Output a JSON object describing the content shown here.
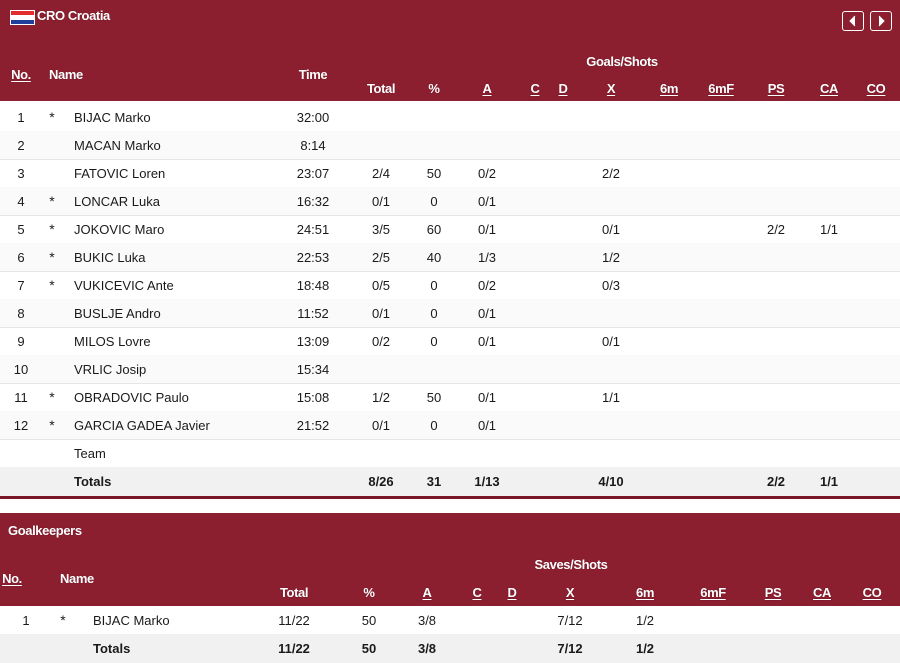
{
  "team": {
    "label": "CRO Croatia",
    "flag_colors": [
      "#e12d2d",
      "#ffffff",
      "#1e3f9c"
    ]
  },
  "nav": {
    "prev_icon": "chevron-left-icon",
    "next_icon": "chevron-right-icon"
  },
  "colors": {
    "band": "#8b1e2f",
    "divider": "#7a1828"
  },
  "players_table": {
    "group_label": "Goals/Shots",
    "headers": {
      "no": "No.",
      "name": "Name",
      "time": "Time",
      "total": "Total",
      "pct": "%",
      "a": "A",
      "c": "C",
      "d": "D",
      "x": "X",
      "m6": "6m",
      "m6f": "6mF",
      "ps": "PS",
      "ca": "CA",
      "co": "CO"
    },
    "rows": [
      {
        "no": "1",
        "star": "*",
        "name": "BIJAC Marko",
        "time": "32:00",
        "total": "",
        "pct": "",
        "a": "",
        "x": "",
        "ps": "",
        "ca": ""
      },
      {
        "no": "2",
        "star": "",
        "name": "MACAN Marko",
        "time": "8:14",
        "total": "",
        "pct": "",
        "a": "",
        "x": "",
        "ps": "",
        "ca": ""
      },
      {
        "no": "3",
        "star": "",
        "name": "FATOVIC Loren",
        "time": "23:07",
        "total": "2/4",
        "pct": "50",
        "a": "0/2",
        "x": "2/2",
        "ps": "",
        "ca": ""
      },
      {
        "no": "4",
        "star": "*",
        "name": "LONCAR Luka",
        "time": "16:32",
        "total": "0/1",
        "pct": "0",
        "a": "0/1",
        "x": "",
        "ps": "",
        "ca": ""
      },
      {
        "no": "5",
        "star": "*",
        "name": "JOKOVIC Maro",
        "time": "24:51",
        "total": "3/5",
        "pct": "60",
        "a": "0/1",
        "x": "0/1",
        "ps": "2/2",
        "ca": "1/1"
      },
      {
        "no": "6",
        "star": "*",
        "name": "BUKIC Luka",
        "time": "22:53",
        "total": "2/5",
        "pct": "40",
        "a": "1/3",
        "x": "1/2",
        "ps": "",
        "ca": ""
      },
      {
        "no": "7",
        "star": "*",
        "name": "VUKICEVIC Ante",
        "time": "18:48",
        "total": "0/5",
        "pct": "0",
        "a": "0/2",
        "x": "0/3",
        "ps": "",
        "ca": ""
      },
      {
        "no": "8",
        "star": "",
        "name": "BUSLJE Andro",
        "time": "11:52",
        "total": "0/1",
        "pct": "0",
        "a": "0/1",
        "x": "",
        "ps": "",
        "ca": ""
      },
      {
        "no": "9",
        "star": "",
        "name": "MILOS Lovre",
        "time": "13:09",
        "total": "0/2",
        "pct": "0",
        "a": "0/1",
        "x": "0/1",
        "ps": "",
        "ca": ""
      },
      {
        "no": "10",
        "star": "",
        "name": "VRLIC Josip",
        "time": "15:34",
        "total": "",
        "pct": "",
        "a": "",
        "x": "",
        "ps": "",
        "ca": ""
      },
      {
        "no": "11",
        "star": "*",
        "name": "OBRADOVIC Paulo",
        "time": "15:08",
        "total": "1/2",
        "pct": "50",
        "a": "0/1",
        "x": "1/1",
        "ps": "",
        "ca": ""
      },
      {
        "no": "12",
        "star": "*",
        "name": "GARCIA GADEA Javier",
        "time": "21:52",
        "total": "0/1",
        "pct": "0",
        "a": "0/1",
        "x": "",
        "ps": "",
        "ca": ""
      },
      {
        "no": "",
        "star": "",
        "name": "Team",
        "time": "",
        "total": "",
        "pct": "",
        "a": "",
        "x": "",
        "ps": "",
        "ca": ""
      }
    ],
    "totals": {
      "label": "Totals",
      "total": "8/26",
      "pct": "31",
      "a": "1/13",
      "x": "4/10",
      "ps": "2/2",
      "ca": "1/1"
    }
  },
  "goalkeepers_table": {
    "title": "Goalkeepers",
    "group_label": "Saves/Shots",
    "headers": {
      "no": "No.",
      "name": "Name",
      "total": "Total",
      "pct": "%",
      "a": "A",
      "c": "C",
      "d": "D",
      "x": "X",
      "m6": "6m",
      "m6f": "6mF",
      "ps": "PS",
      "ca": "CA",
      "co": "CO"
    },
    "rows": [
      {
        "no": "1",
        "star": "*",
        "name": "BIJAC Marko",
        "total": "11/22",
        "pct": "50",
        "a": "3/8",
        "x": "7/12",
        "m6": "1/2"
      }
    ],
    "totals": {
      "label": "Totals",
      "total": "11/22",
      "pct": "50",
      "a": "3/8",
      "x": "7/12",
      "m6": "1/2"
    }
  }
}
